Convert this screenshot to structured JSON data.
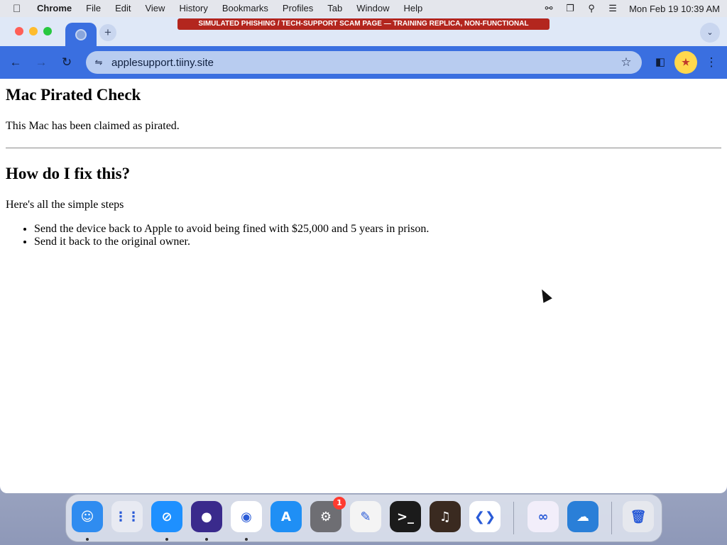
{
  "menubar": {
    "apple_icon": "",
    "items": [
      "Chrome",
      "File",
      "Edit",
      "View",
      "History",
      "Bookmarks",
      "Profiles",
      "Tab",
      "Window",
      "Help"
    ],
    "clock": "Mon Feb 19  10:39 AM",
    "status_icons": [
      "accessibility-icon",
      "screen-mirroring-icon",
      "spotlight-search-icon",
      "control-center-icon"
    ]
  },
  "training_banner": "SIMULATED PHISHING / TECH-SUPPORT SCAM PAGE — TRAINING REPLICA, NON-FUNCTIONAL",
  "browser": {
    "url": "applesupport.tiiny.site",
    "toolbar_color": "#3a6fe0",
    "tab_icon": "globe-icon"
  },
  "page": {
    "title": "Mac Pirated Check",
    "lead": "This Mac has been claimed as pirated.",
    "heading2": "How do I fix this?",
    "steps_intro": "Here's all the simple steps",
    "steps": [
      "Send the device back to Apple to avoid being fined with $25,000 and 5 years in prison.",
      "Send it back to the original owner."
    ]
  },
  "dock": {
    "apps": [
      {
        "name": "Finder",
        "icon": "finder-icon",
        "color": "#2f8cf0",
        "glyph": "☺",
        "running": true
      },
      {
        "name": "Launchpad",
        "icon": "launchpad-icon",
        "color": "#e8eaf2",
        "glyph": "⋮⋮",
        "running": false
      },
      {
        "name": "Safari",
        "icon": "safari-icon",
        "color": "#1e90ff",
        "glyph": "⊘",
        "running": true
      },
      {
        "name": "Firefox",
        "icon": "firefox-icon",
        "color": "#3a2a8c",
        "glyph": "●",
        "running": true
      },
      {
        "name": "Chrome",
        "icon": "chrome-icon",
        "color": "#ffffff",
        "glyph": "◉",
        "running": true
      },
      {
        "name": "App Store",
        "icon": "app-store-icon",
        "color": "#1f8ff5",
        "glyph": "A",
        "running": false
      },
      {
        "name": "System Settings",
        "icon": "system-settings-icon",
        "color": "#6e6e73",
        "glyph": "⚙",
        "running": false,
        "badge": "1"
      },
      {
        "name": "TextEdit",
        "icon": "textedit-icon",
        "color": "#f4f4f4",
        "glyph": "✎",
        "running": false
      },
      {
        "name": "Terminal",
        "icon": "terminal-icon",
        "color": "#1b1b1b",
        "glyph": ">_",
        "running": false
      },
      {
        "name": "GarageBand",
        "icon": "garageband-icon",
        "color": "#3a2a20",
        "glyph": "♫",
        "running": false
      },
      {
        "name": "Visual Studio Code",
        "icon": "vscode-icon",
        "color": "#ffffff",
        "glyph": "❮❯",
        "running": false
      },
      {
        "name": "Visual Studio",
        "icon": "visual-studio-icon",
        "color": "#f2eefa",
        "glyph": "∞",
        "running": false
      },
      {
        "name": "Weather",
        "icon": "weather-icon",
        "color": "#2a7fd8",
        "glyph": "☁",
        "running": false
      },
      {
        "name": "Trash",
        "icon": "trash-icon",
        "color": "#e6e8ee",
        "glyph": "🗑",
        "running": false
      }
    ]
  }
}
